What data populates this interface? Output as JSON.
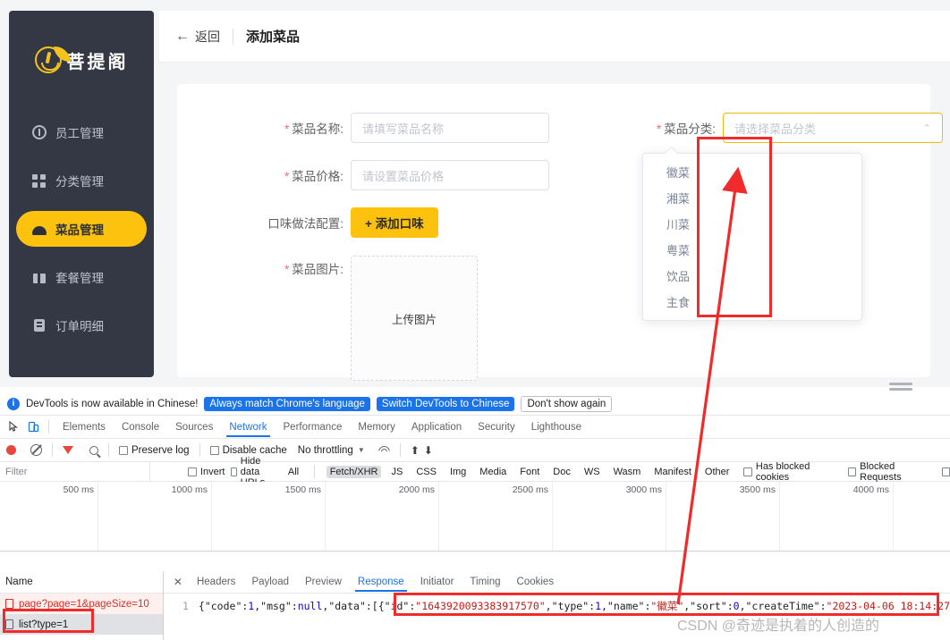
{
  "app": {
    "brand": {
      "name": "菩提阁",
      "logo_icon": "leaf-circle-logo"
    },
    "sidebar": {
      "items": [
        {
          "label": "员工管理",
          "icon": "info-circle-icon",
          "active": false
        },
        {
          "label": "分类管理",
          "icon": "grid-icon",
          "active": false
        },
        {
          "label": "菜品管理",
          "icon": "dish-cloche-icon",
          "active": true
        },
        {
          "label": "套餐管理",
          "icon": "gift-icon",
          "active": false
        },
        {
          "label": "订单明细",
          "icon": "clipboard-icon",
          "active": false
        }
      ]
    },
    "topbar": {
      "back_label": "返回",
      "back_icon": "arrow-left-icon",
      "title": "添加菜品"
    },
    "form": {
      "name": {
        "label": "菜品名称:",
        "required": "*",
        "placeholder": "请填写菜品名称",
        "value": ""
      },
      "price": {
        "label": "菜品价格:",
        "required": "*",
        "placeholder": "请设置菜品价格",
        "value": ""
      },
      "flavor": {
        "label": "口味做法配置:",
        "button_label": "+ 添加口味"
      },
      "image": {
        "label": "菜品图片:",
        "required": "*",
        "upload_text": "上传图片"
      },
      "category": {
        "label": "菜品分类:",
        "required": "*",
        "placeholder": "请选择菜品分类",
        "value": "",
        "caret_icon": "chevron-up-icon",
        "options": [
          "徽菜",
          "湘菜",
          "川菜",
          "粤菜",
          "饮品",
          "主食"
        ]
      }
    }
  },
  "devtools": {
    "banner": {
      "message": "DevTools is now available in Chinese!",
      "info_icon": "info-icon",
      "buttons": [
        {
          "label": "Always match Chrome's language",
          "style": "primary"
        },
        {
          "label": "Switch DevTools to Chinese",
          "style": "primary"
        },
        {
          "label": "Don't show again",
          "style": "plain"
        }
      ]
    },
    "tabs": {
      "inspect_icon": "inspect-cursor-icon",
      "device_icon": "device-toolbar-icon",
      "items": [
        "Elements",
        "Console",
        "Sources",
        "Network",
        "Performance",
        "Memory",
        "Application",
        "Security",
        "Lighthouse"
      ],
      "active": "Network"
    },
    "toolbar": {
      "record_icon": "record-dot-icon",
      "clear_icon": "clear-icon",
      "filter_icon": "funnel-icon",
      "search_icon": "search-icon",
      "preserve_log": "Preserve log",
      "disable_cache": "Disable cache",
      "throttling": "No throttling",
      "throttle_caret_icon": "chevron-down-icon",
      "wifi_icon": "network-conditions-icon",
      "import_icon": "import-har-icon",
      "export_icon": "export-har-icon"
    },
    "filterbar": {
      "placeholder": "Filter",
      "invert": "Invert",
      "hide_data_urls": "Hide data URLs",
      "types": [
        "All",
        "Fetch/XHR",
        "JS",
        "CSS",
        "Img",
        "Media",
        "Font",
        "Doc",
        "WS",
        "Wasm",
        "Manifest",
        "Other"
      ],
      "selected_type": "Fetch/XHR",
      "has_blocked_cookies": "Has blocked cookies",
      "blocked_requests": "Blocked Requests"
    },
    "timeline": {
      "ticks": [
        "500 ms",
        "1000 ms",
        "1500 ms",
        "2000 ms",
        "2500 ms",
        "3000 ms",
        "3500 ms",
        "4000 ms"
      ]
    },
    "requests": {
      "header": "Name",
      "rows": [
        {
          "name": "page?page=1&pageSize=10",
          "state": "error"
        },
        {
          "name": "list?type=1",
          "state": "selected"
        }
      ]
    },
    "response": {
      "close_icon": "close-icon",
      "tabs": [
        "Headers",
        "Payload",
        "Preview",
        "Response",
        "Initiator",
        "Timing",
        "Cookies"
      ],
      "active_tab": "Response",
      "line_number": "1",
      "json_tokens": [
        {
          "t": "{\"code\":",
          "c": "key"
        },
        {
          "t": "1",
          "c": "num"
        },
        {
          "t": ",\"msg\":",
          "c": "key"
        },
        {
          "t": "null",
          "c": "null"
        },
        {
          "t": ",\"data\":[{\"id\":",
          "c": "key"
        },
        {
          "t": "\"1643920093383917570\"",
          "c": "str"
        },
        {
          "t": ",\"type\":",
          "c": "key"
        },
        {
          "t": "1",
          "c": "num"
        },
        {
          "t": ",\"name\":",
          "c": "key"
        },
        {
          "t": "\"徽菜\"",
          "c": "str"
        },
        {
          "t": ",\"sort\":",
          "c": "key"
        },
        {
          "t": "0",
          "c": "num"
        },
        {
          "t": ",\"createTime\":",
          "c": "key"
        },
        {
          "t": "\"2023-04-06 18:14:27",
          "c": "str"
        }
      ]
    }
  },
  "annotations": {
    "watermark": "CSDN @奇迹是执着的人创造的",
    "highlight_color": "#ef2b2b",
    "arrow": "points from response JSON name field up to dropdown option list"
  },
  "colors": {
    "brand_yellow": "#fdc20e",
    "sidebar_dark": "#343744",
    "devtools_blue": "#1a73e8",
    "error_red": "#d93025",
    "annotation_red": "#ef2b2b"
  }
}
